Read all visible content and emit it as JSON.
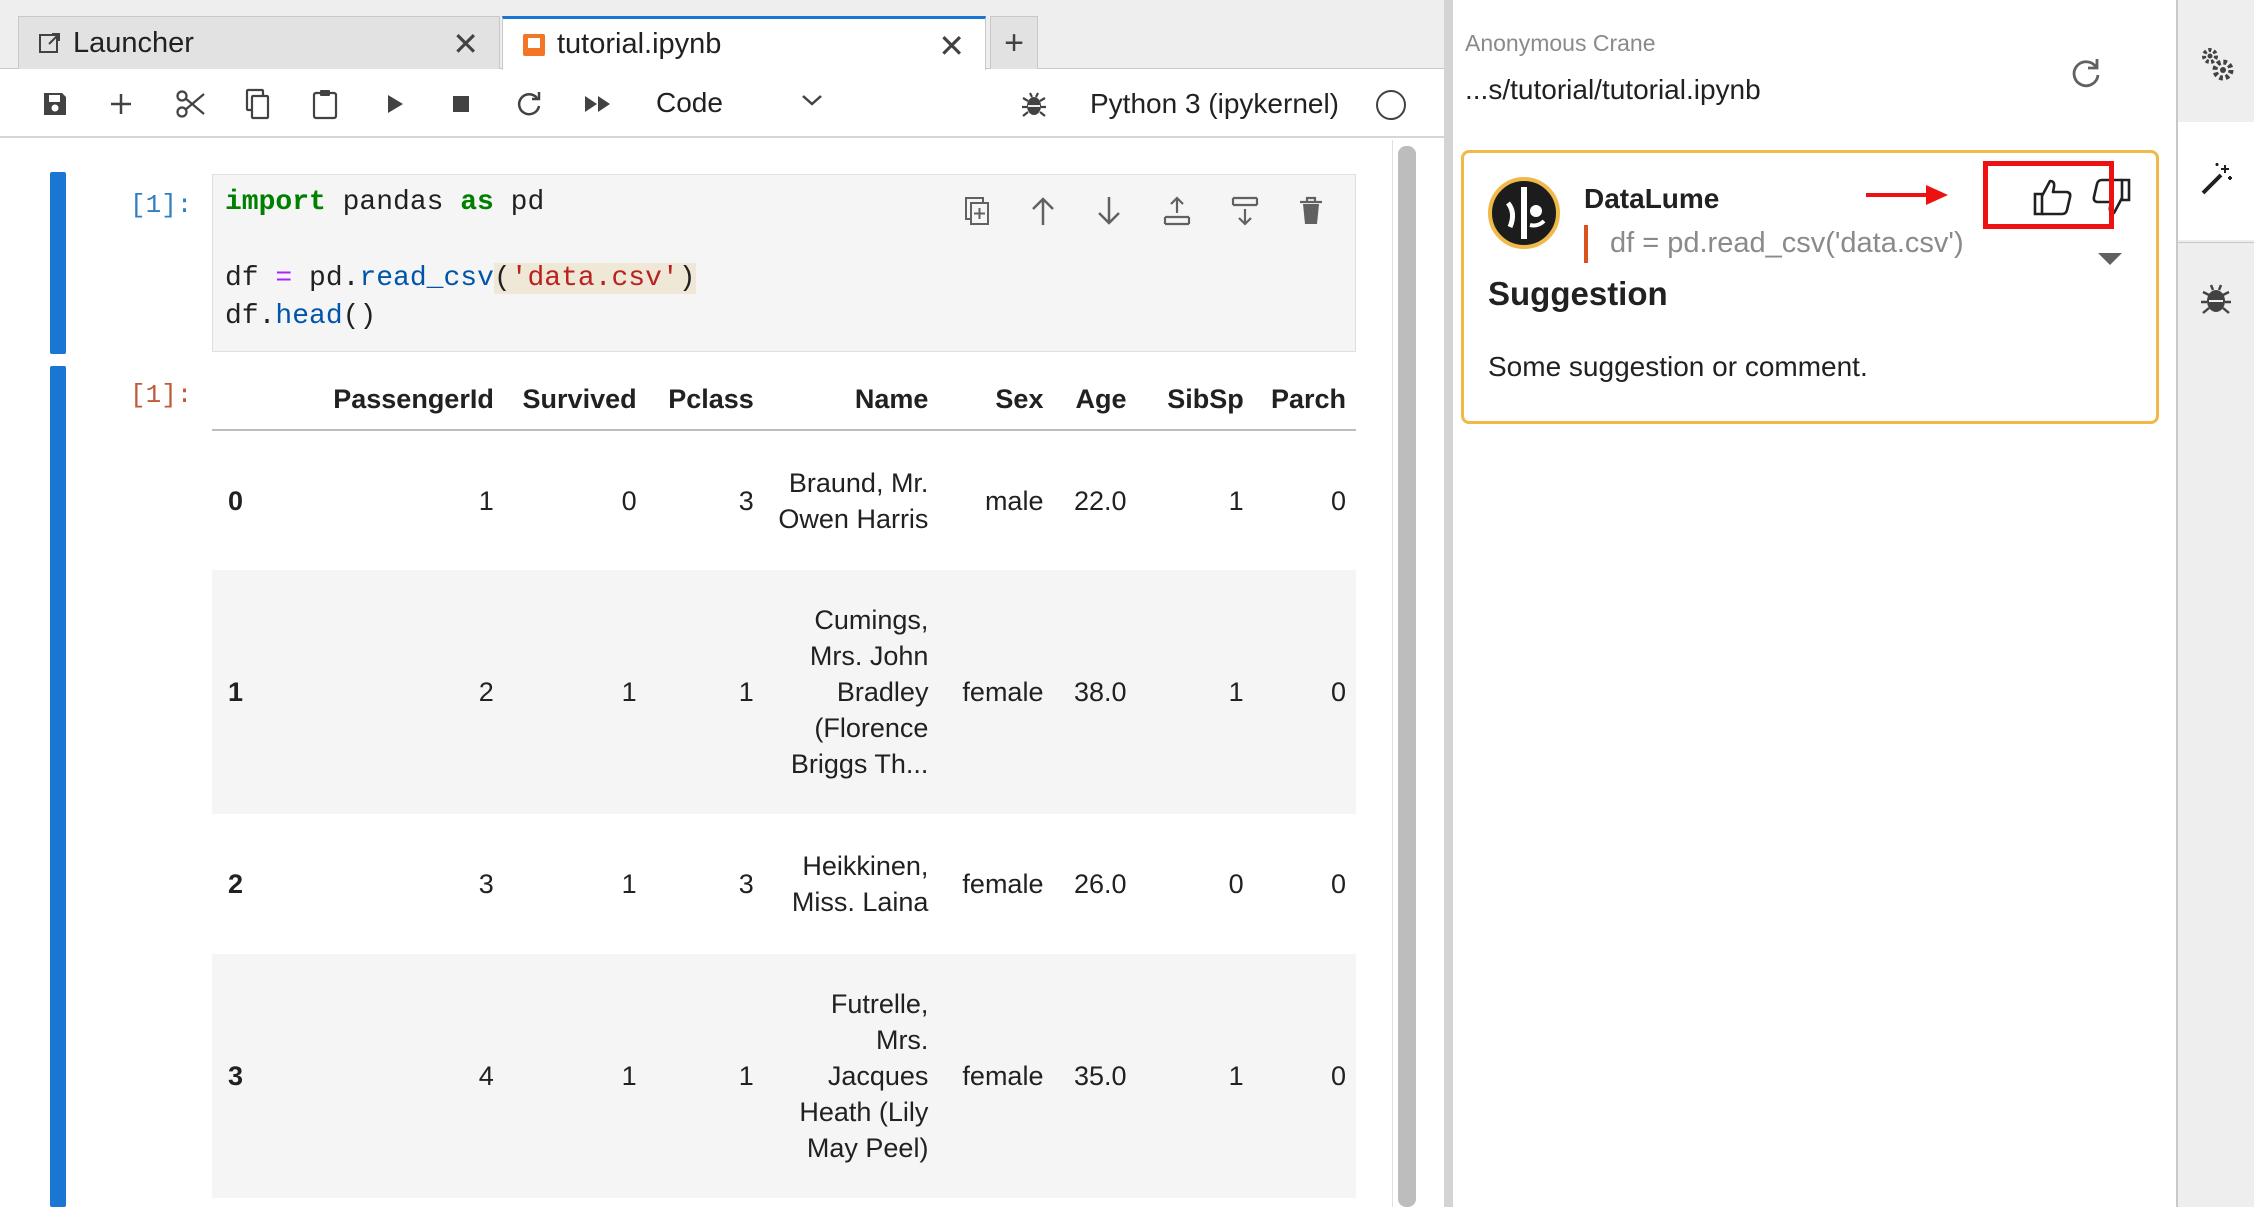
{
  "tabs": [
    {
      "label": "Launcher",
      "icon": "launcher-icon",
      "close": "✕"
    },
    {
      "label": "tutorial.ipynb",
      "icon": "notebook-icon",
      "close": "✕"
    }
  ],
  "tab_add": "+",
  "toolbar": {
    "cell_type": "Code",
    "kernel": "Python 3 (ipykernel)"
  },
  "cell": {
    "in_prompt": "[1]:",
    "out_prompt": "[1]:",
    "code": {
      "line1_kw1": "import",
      "line1_mid": " pandas ",
      "line1_kw2": "as",
      "line1_end": " pd",
      "line3_df": "df ",
      "line3_eq": "=",
      "line3_pd": " pd.",
      "line3_fn": "read_csv",
      "line3_p1": "(",
      "line3_str": "'data.csv'",
      "line3_p2": ")",
      "line4_obj": "df.",
      "line4_fn": "head",
      "line4_p": "()"
    }
  },
  "dataframe": {
    "columns": [
      "",
      "PassengerId",
      "Survived",
      "Pclass",
      "Name",
      "Sex",
      "Age",
      "SibSp",
      "Parch"
    ],
    "rows": [
      {
        "index": "0",
        "PassengerId": "1",
        "Survived": "0",
        "Pclass": "3",
        "Name": "Braund, Mr. Owen Harris",
        "Sex": "male",
        "Age": "22.0",
        "SibSp": "1",
        "Parch": "0"
      },
      {
        "index": "1",
        "PassengerId": "2",
        "Survived": "1",
        "Pclass": "1",
        "Name": "Cumings, Mrs. John Bradley (Florence Briggs Th...",
        "Sex": "female",
        "Age": "38.0",
        "SibSp": "1",
        "Parch": "0"
      },
      {
        "index": "2",
        "PassengerId": "3",
        "Survived": "1",
        "Pclass": "3",
        "Name": "Heikkinen, Miss. Laina",
        "Sex": "female",
        "Age": "26.0",
        "SibSp": "0",
        "Parch": "0"
      },
      {
        "index": "3",
        "PassengerId": "4",
        "Survived": "1",
        "Pclass": "1",
        "Name": "Futrelle, Mrs. Jacques Heath (Lily May Peel)",
        "Sex": "female",
        "Age": "35.0",
        "SibSp": "1",
        "Parch": "0"
      }
    ]
  },
  "panel": {
    "user": "Anonymous Crane",
    "path": "...s/tutorial/tutorial.ipynb",
    "card": {
      "bot": "DataLume",
      "quote": "df = pd.read_csv('data.csv')",
      "title": "Suggestion",
      "body": "Some suggestion or comment."
    }
  },
  "colors": {
    "accent": "#1976d2",
    "card_border": "#f0b94a",
    "highlight": "#ee1111",
    "quote_bar": "#d9531e"
  }
}
